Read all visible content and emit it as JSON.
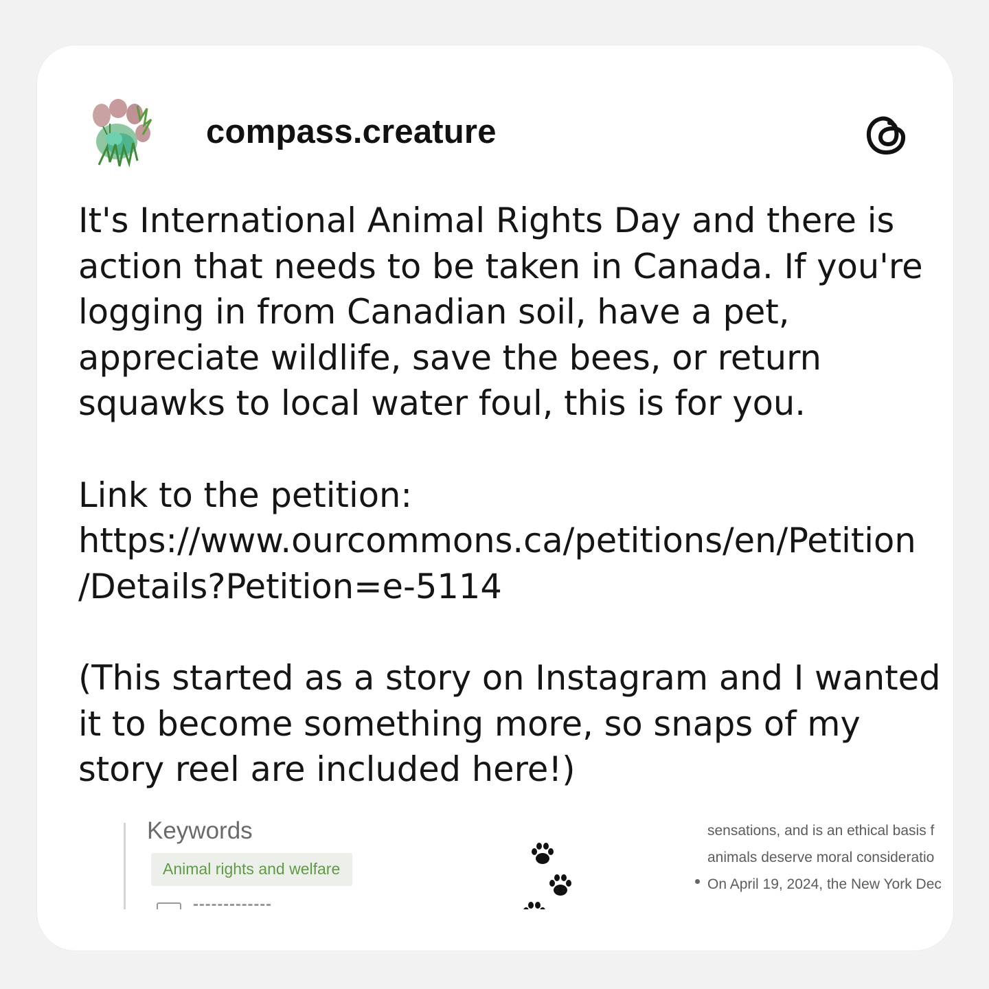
{
  "post": {
    "username": "compass.creature",
    "avatar_icon": "paw-print-icon",
    "app_icon": "threads-logo-icon",
    "paragraph1": [
      "It's International Animal Rights Day and there is",
      "action that needs to be taken in Canada. If you're",
      "logging in from Canadian soil, have a pet,",
      "appreciate wildlife, save the bees, or return",
      "squawks to local water foul, this is for you."
    ],
    "paragraph2": [
      "Link to the petition:",
      "https://www.ourcommons.ca/petitions/en/Petition",
      "/Details?Petition=e-5114"
    ],
    "paragraph3": [
      "(This started as a story on Instagram and I wanted",
      "it to become something more, so snaps of my",
      "story reel are included here!)"
    ]
  },
  "snaps": {
    "keywords_title": "Keywords",
    "keyword_chip": "Animal rights and welfare",
    "paw_icon": "paw-print-icon",
    "article_lines": [
      "sensations, and is an ethical basis f",
      "animals deserve moral consideratio",
      "On April 19, 2024, the New York Dec"
    ]
  },
  "colors": {
    "background": "#f2f2f2",
    "card": "#ffffff",
    "text": "#151515",
    "chip_bg": "#edf0ea",
    "chip_text": "#5f9a45"
  }
}
